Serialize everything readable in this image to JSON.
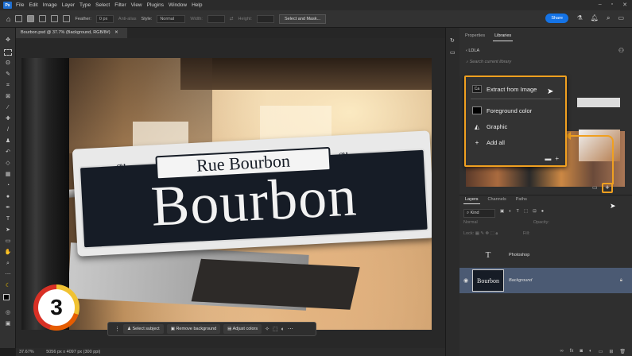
{
  "menubar": {
    "logo": "Ps",
    "items": [
      "File",
      "Edit",
      "Image",
      "Layer",
      "Type",
      "Select",
      "Filter",
      "View",
      "Plugins",
      "Window",
      "Help"
    ]
  },
  "options": {
    "feather_label": "Feather:",
    "feather_value": "0 px",
    "antialias_label": "Anti-alias",
    "style_label": "Style:",
    "style_value": "Normal",
    "width_label": "Width:",
    "height_label": "Height:",
    "select_mask_button": "Select and Mask...",
    "share_button": "Share"
  },
  "document": {
    "tab_title": "Bourbon.psd @ 37.7% (Background, RGB/8#)",
    "status_zoom": "37.67%",
    "status_info": "5056 px x 4097 px (300 ppi)"
  },
  "image_content": {
    "sign_top": "Rue Bourbon",
    "sign_main": "Bourbon"
  },
  "step_badge": "3",
  "contextual_bar": {
    "select_subject": "Select subject",
    "remove_background": "Remove background",
    "adjust_colors": "Adjust colors"
  },
  "libraries": {
    "tabs": [
      "Properties",
      "Libraries"
    ],
    "active_tab": "Libraries",
    "nav_back": "‹ LDLA",
    "search_placeholder": "Search current library"
  },
  "popup_menu": {
    "items": [
      {
        "label": "Extract from Image",
        "icon": "ca-icon"
      },
      {
        "label": "Foreground color",
        "icon": "foreground-swatch-icon"
      },
      {
        "label": "Graphic",
        "icon": "graphic-icon"
      },
      {
        "label": "Add all",
        "icon": "plus-icon"
      }
    ]
  },
  "layers_panel": {
    "tabs": [
      "Layers",
      "Channels",
      "Paths"
    ],
    "active_tab": "Layers",
    "kind_label": "Kind",
    "blend_mode": "Normal",
    "opacity_label": "Opacity:",
    "lock_label": "Lock:",
    "fill_label": "Fill:",
    "layers": [
      {
        "name": "Photoshop",
        "type": "text"
      },
      {
        "name": "Background",
        "type": "image"
      }
    ]
  },
  "colors": {
    "accent_highlight": "#f0a020",
    "share_blue": "#1473e6",
    "selected_layer": "#4b5a73"
  }
}
